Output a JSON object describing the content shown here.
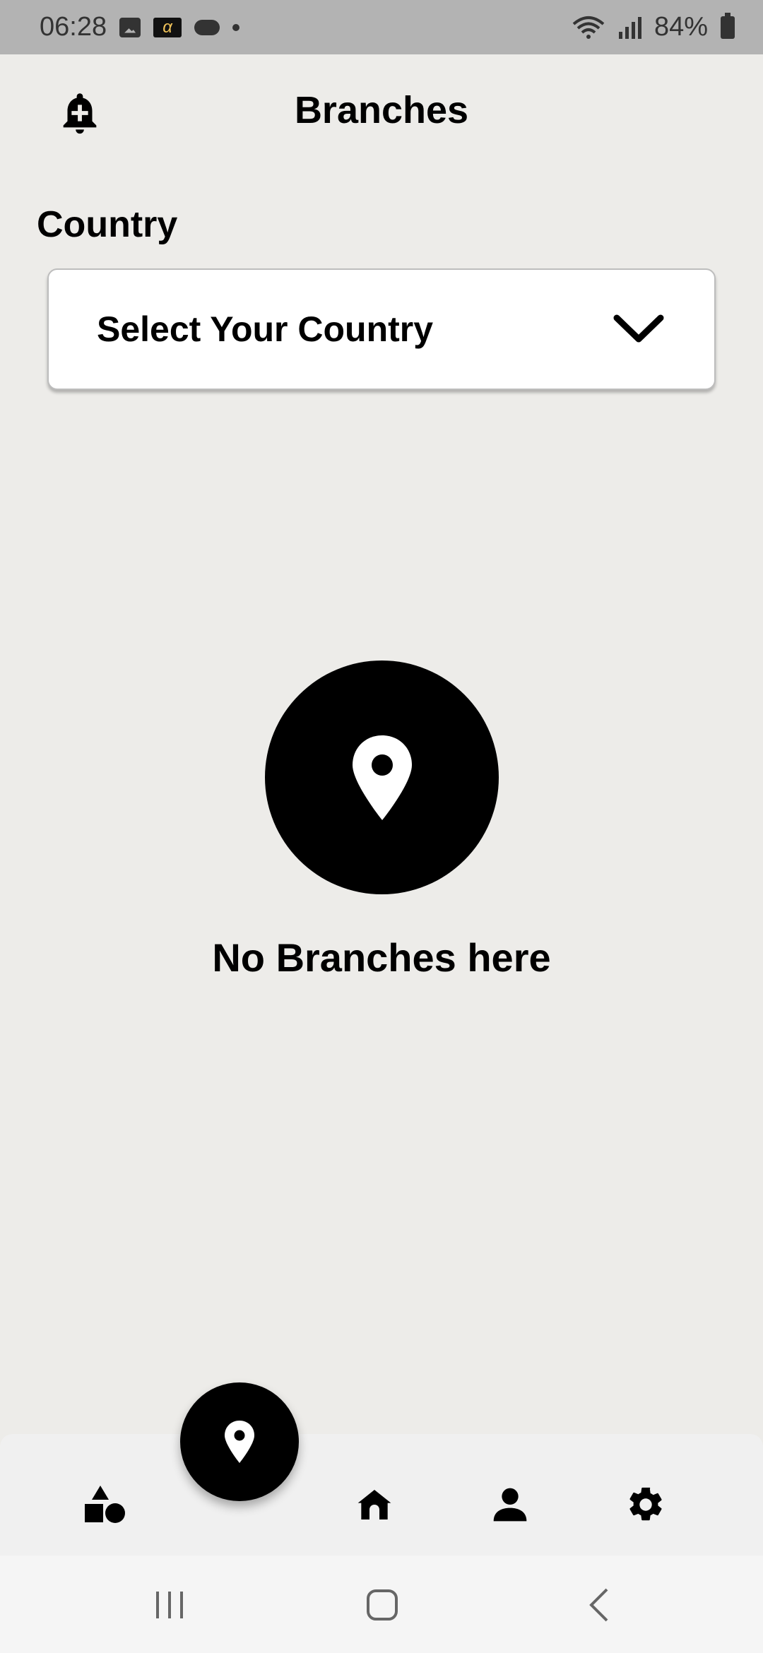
{
  "status_bar": {
    "time": "06:28",
    "battery": "84%",
    "icons": [
      "image-icon",
      "alpha-app-icon",
      "cloud-icon",
      "dot-icon",
      "wifi-icon",
      "signal-icon",
      "battery-icon"
    ]
  },
  "header": {
    "title": "Branches",
    "left_icon": "bell-plus-icon"
  },
  "country": {
    "label": "Country",
    "select_value": "Select Your Country"
  },
  "empty_state": {
    "icon": "location-pin-icon",
    "message": "No Branches here"
  },
  "bottom_nav": {
    "items": [
      {
        "icon": "shapes-icon"
      },
      {
        "icon": "location-pin-icon",
        "active": true
      },
      {
        "icon": "home-icon"
      },
      {
        "icon": "person-icon"
      },
      {
        "icon": "gear-icon"
      }
    ]
  },
  "system_nav": {
    "buttons": [
      "recents-icon",
      "home-button-icon",
      "back-icon"
    ]
  },
  "colors": {
    "background": "#EDECE9",
    "status_bar": "#B3B3B3",
    "accent": "#000000",
    "nav_background": "#F0F0F0"
  }
}
